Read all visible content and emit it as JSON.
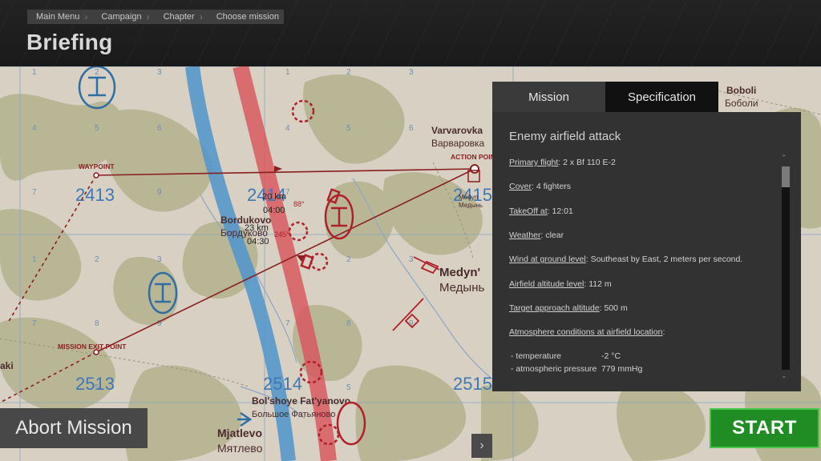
{
  "breadcrumb": [
    "Main Menu",
    "Campaign",
    "Chapter",
    "Choose mission"
  ],
  "page_title": "Briefing",
  "map": {
    "grid_labels": [
      "2413",
      "2414",
      "2415",
      "2513",
      "2514",
      "2515"
    ],
    "towns": [
      {
        "latin": "Varvarovka",
        "cyrillic": "Варваровка"
      },
      {
        "latin": "Bordukovo",
        "cyrillic": "Бордуково"
      },
      {
        "latin": "Medyn'",
        "cyrillic": "Медынь"
      },
      {
        "latin": "Bol'shoye Fat'yanovo",
        "cyrillic": "Большое Фатьяново"
      },
      {
        "latin": "Mjatlevo",
        "cyrillic": "Мятлево"
      },
      {
        "latin": "Boboli",
        "cyrillic": "Боболи"
      },
      {
        "latin": "aki",
        "cyrillic": ""
      },
      {
        "latin": "Medyn",
        "cyrillic": "Медынь"
      }
    ],
    "markers": {
      "waypoint": "WAYPOINT",
      "action_point": "ACTION POINT",
      "mission_exit": "MISSION EXIT POINT"
    },
    "legs": [
      {
        "distance": "20 km",
        "time": "04:00",
        "heading": "88°"
      },
      {
        "distance": "23 km",
        "time": "04:30",
        "heading": "245°"
      }
    ],
    "colors": {
      "land": "#d7d0c3",
      "forest": "#b7b492",
      "friendly": "#2f6ea3",
      "enemy": "#b0202a",
      "front_red": "#d9535a",
      "front_blue": "#4f95cc"
    }
  },
  "panel": {
    "tabs": [
      "Mission",
      "Specification"
    ],
    "active_tab": "Mission",
    "mission_title": "Enemy airfield attack",
    "rows": [
      {
        "label": "Primary flight",
        "value": ": 2 x Bf 110 E-2"
      },
      {
        "label": "Cover",
        "value": ": 4 fighters"
      },
      {
        "label": "TakeOff at",
        "value": ": 12:01"
      },
      {
        "label": "Weather",
        "value": ": clear"
      },
      {
        "label": "Wind at ground level",
        "value": ": Southeast by East, 2 meters per second."
      },
      {
        "label": "Airfield altitude level",
        "value": ": 112 m"
      },
      {
        "label": "Target approach altitude",
        "value": ": 500 m"
      },
      {
        "label": "Atmosphere conditions at airfield location",
        "value": ":"
      }
    ],
    "conditions": [
      {
        "label": "- temperature",
        "value": "-2 °C"
      },
      {
        "label": "- atmospheric pressure",
        "value": "779 mmHg"
      }
    ]
  },
  "buttons": {
    "abort": "Abort Mission",
    "start": "START",
    "next": "›"
  }
}
